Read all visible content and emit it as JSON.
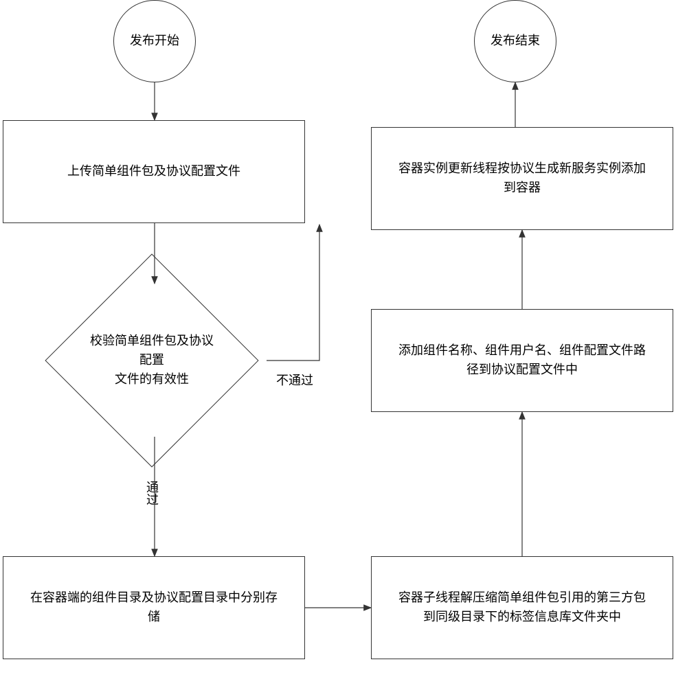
{
  "nodes": {
    "start": "发布开始",
    "end": "发布结束",
    "upload": "上传简单组件包及协议配置文件",
    "validate": "校验简单组件包及协议配置\n文件的有效性",
    "store": "在容器端的组件目录及协议配置目录中分别存\n储",
    "extract": "容器子线程解压缩简单组件包引用的第三方包\n到同级目录下的标签信息库文件夹中",
    "addConfig": "添加组件名称、组件用户名、组件配置文件路\n径到协议配置文件中",
    "updateThread": "容器实例更新线程按协议生成新服务实例添加\n到容器"
  },
  "edgeLabels": {
    "fail": "不通过",
    "pass": "通过"
  },
  "chart_data": {
    "type": "table",
    "title": "Flowchart: 组件发布流程",
    "nodes": [
      {
        "id": "start",
        "type": "terminator",
        "label": "发布开始"
      },
      {
        "id": "upload",
        "type": "process",
        "label": "上传简单组件包及协议配置文件"
      },
      {
        "id": "validate",
        "type": "decision",
        "label": "校验简单组件包及协议配置文件的有效性"
      },
      {
        "id": "store",
        "type": "process",
        "label": "在容器端的组件目录及协议配置目录中分别存储"
      },
      {
        "id": "extract",
        "type": "process",
        "label": "容器子线程解压缩简单组件包引用的第三方包到同级目录下的标签信息库文件夹中"
      },
      {
        "id": "addConfig",
        "type": "process",
        "label": "添加组件名称、组件用户名、组件配置文件路径到协议配置文件中"
      },
      {
        "id": "updateThread",
        "type": "process",
        "label": "容器实例更新线程按协议生成新服务实例添加到容器"
      },
      {
        "id": "end",
        "type": "terminator",
        "label": "发布结束"
      }
    ],
    "edges": [
      {
        "from": "start",
        "to": "upload"
      },
      {
        "from": "upload",
        "to": "validate"
      },
      {
        "from": "validate",
        "to": "upload",
        "label": "不通过"
      },
      {
        "from": "validate",
        "to": "store",
        "label": "通过"
      },
      {
        "from": "store",
        "to": "extract"
      },
      {
        "from": "extract",
        "to": "addConfig"
      },
      {
        "from": "addConfig",
        "to": "updateThread"
      },
      {
        "from": "updateThread",
        "to": "end"
      }
    ]
  }
}
